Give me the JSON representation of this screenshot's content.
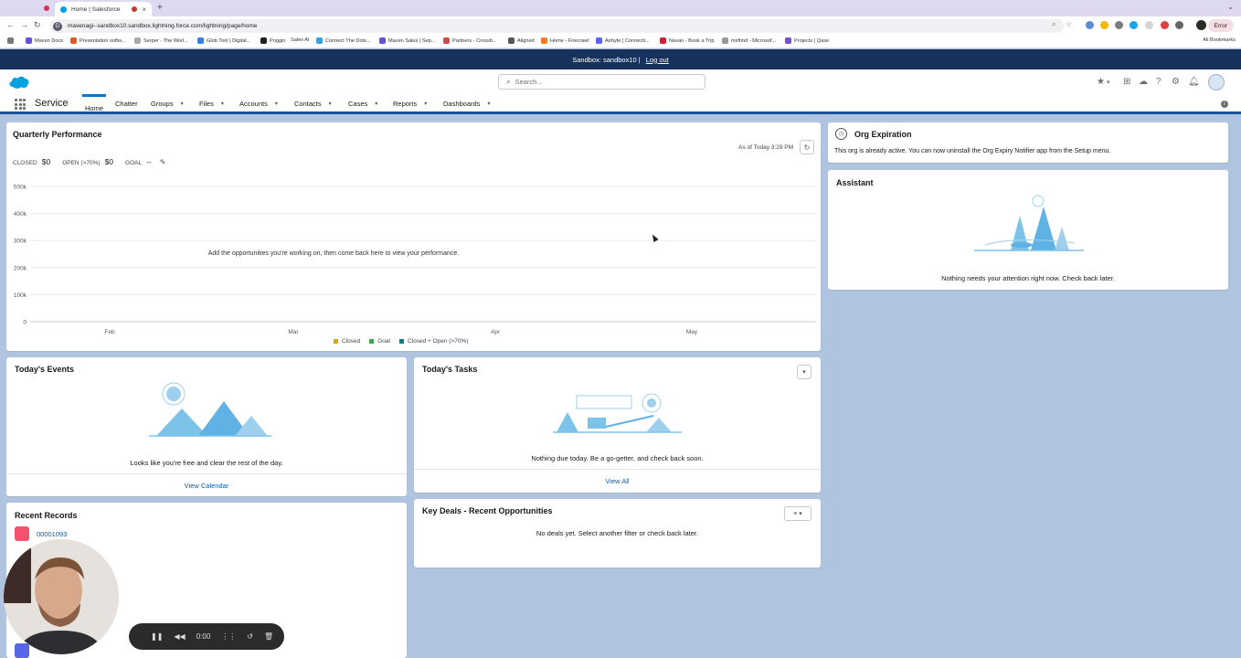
{
  "browser": {
    "tab_title": "Home | Salesforce",
    "url": "mavenagi--sandbox10.sandbox.lightning.force.com/lightning/page/home",
    "error_label": "Error",
    "bookmarks": [
      "Maven Docs",
      "Presentation softw...",
      "Serper - The Worl...",
      "Glob Tool | Digital...",
      "Poggio",
      "Sales AI",
      "Connect The Dots...",
      "Maven Sales | Sep...",
      "Partners - Crossb...",
      "Aligned",
      "Home - Firecrawl",
      "Airbyte | Connecti...",
      "Navan - Book a Trip",
      "msftmd - Microsof...",
      "Projects | Qase"
    ],
    "all_bookmarks": "All Bookmarks"
  },
  "sandbox_bar": {
    "text": "Sandbox: sandbox10 |",
    "logout": "Log out"
  },
  "header": {
    "search_placeholder": "Search..."
  },
  "nav": {
    "app_name": "Service",
    "items": [
      "Home",
      "Chatter",
      "Groups",
      "Files",
      "Accounts",
      "Contacts",
      "Cases",
      "Reports",
      "Dashboards"
    ]
  },
  "quarterly": {
    "title": "Quarterly Performance",
    "as_of": "As of Today 3:29 PM",
    "closed_label": "CLOSED",
    "closed_value": "$0",
    "open_label": "OPEN (>70%)",
    "open_value": "$0",
    "goal_label": "GOAL",
    "goal_value": "--",
    "empty_message": "Add the opportunities you're working on, then come back here to view your performance.",
    "legend": [
      "Closed",
      "Goal",
      "Closed + Open (>70%)"
    ]
  },
  "chart_data": {
    "type": "line",
    "x": [
      "Feb",
      "Mar",
      "Apr",
      "May"
    ],
    "y_ticks": [
      "500k",
      "400k",
      "300k",
      "200k",
      "100k",
      "0"
    ],
    "ylim": [
      0,
      500000
    ],
    "series": [
      {
        "name": "Closed",
        "values": [],
        "color": "#e4a201"
      },
      {
        "name": "Goal",
        "values": [],
        "color": "#3ba755"
      },
      {
        "name": "Closed + Open (>70%)",
        "values": [],
        "color": "#0b827c"
      }
    ],
    "grid": true,
    "legend": "bottom"
  },
  "org_expiration": {
    "title": "Org Expiration",
    "message": "This org is already active. You can now uninstall the Org Expiry Notifier app from the Setup menu."
  },
  "assistant": {
    "title": "Assistant",
    "message": "Nothing needs your attention right now. Check back later."
  },
  "events": {
    "title": "Today's Events",
    "message": "Looks like you're free and clear the rest of the day.",
    "link": "View Calendar"
  },
  "tasks": {
    "title": "Today's Tasks",
    "message": "Nothing due today. Be a go-getter, and check back soon.",
    "link": "View All"
  },
  "recent": {
    "title": "Recent Records",
    "items": [
      "00001093"
    ]
  },
  "deals": {
    "title": "Key Deals - Recent Opportunities",
    "message": "No deals yet. Select another filter or check back later."
  },
  "recorder": {
    "time": "0:00"
  },
  "colors": {
    "brand": "#0176d3",
    "nav_dark": "#16325c",
    "link": "#0b5cab"
  }
}
